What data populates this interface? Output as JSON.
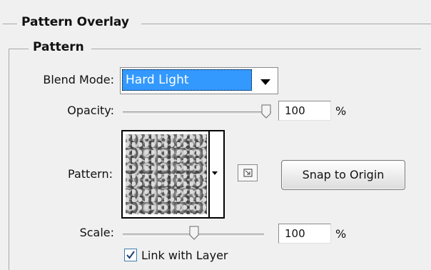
{
  "panel": {
    "title": "Pattern Overlay",
    "group_title": "Pattern"
  },
  "blend_mode": {
    "label": "Blend Mode:",
    "value": "Hard Light"
  },
  "opacity": {
    "label": "Opacity:",
    "value": "100",
    "unit": "%",
    "slider_fraction": 1.0
  },
  "pattern": {
    "label": "Pattern:",
    "snap_button": "Snap to Origin",
    "new_preset_icon": "new-preset-icon"
  },
  "scale": {
    "label": "Scale:",
    "value": "100",
    "unit": "%",
    "slider_fraction": 0.5
  },
  "link_with_layer": {
    "label": "Link with Layer",
    "checked": true
  },
  "colors": {
    "background": "#f0f0f0",
    "selection": "#3399ff",
    "rule": "#a8a8a8"
  }
}
